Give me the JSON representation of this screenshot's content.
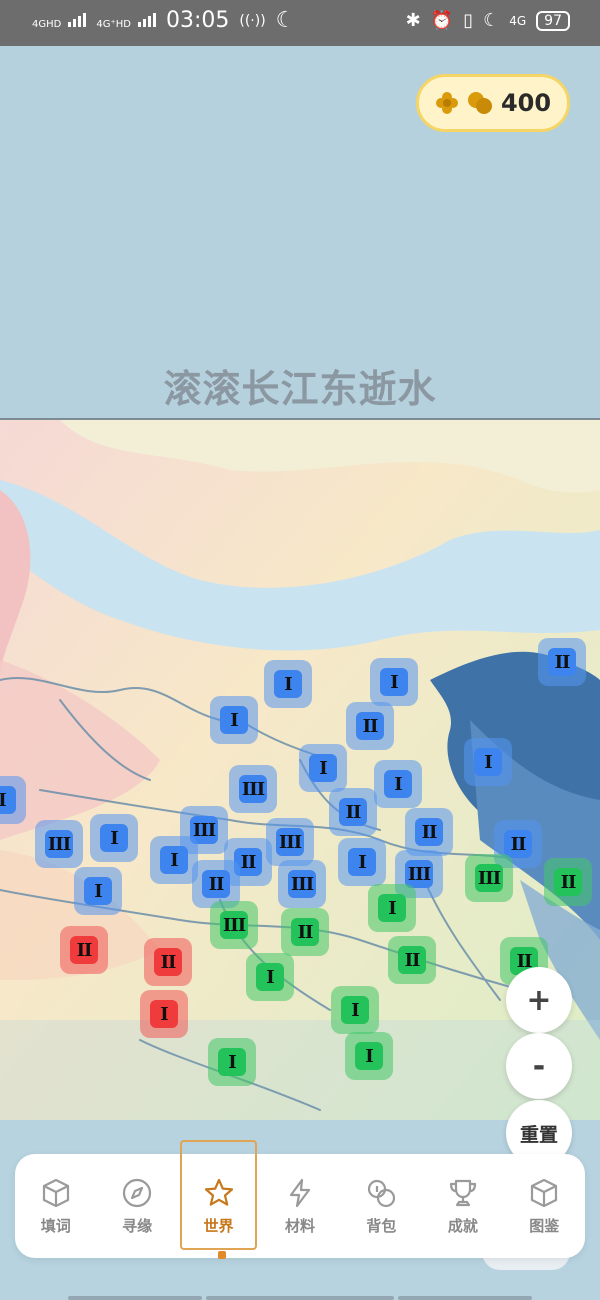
{
  "status_bar": {
    "net1": "4GHD",
    "net2": "4G⁺HD",
    "time": "03:05",
    "net3": "4G",
    "battery": "97"
  },
  "currency": {
    "amount": "400",
    "icon": "coins-icon",
    "flower_icon": "flower-icon"
  },
  "title": "滚滚长江东逝水",
  "map_nodes": [
    {
      "label": "I",
      "color": "blue"
    },
    {
      "label": "I",
      "color": "blue"
    },
    {
      "label": "II",
      "color": "blue"
    },
    {
      "label": "I",
      "color": "blue"
    },
    {
      "label": "II",
      "color": "blue"
    },
    {
      "label": "III",
      "color": "blue"
    },
    {
      "label": "I",
      "color": "blue"
    },
    {
      "label": "I",
      "color": "blue"
    },
    {
      "label": "I",
      "color": "blue"
    },
    {
      "label": "II",
      "color": "blue"
    },
    {
      "label": "III",
      "color": "blue"
    },
    {
      "label": "II",
      "color": "blue"
    },
    {
      "label": "III",
      "color": "blue"
    },
    {
      "label": "I",
      "color": "blue"
    },
    {
      "label": "III",
      "color": "blue"
    },
    {
      "label": "I",
      "color": "blue"
    },
    {
      "label": "II",
      "color": "blue"
    },
    {
      "label": "I",
      "color": "blue"
    },
    {
      "label": "II",
      "color": "blue"
    },
    {
      "label": "III",
      "color": "blue"
    },
    {
      "label": "III",
      "color": "blue"
    },
    {
      "label": "II",
      "color": "blue"
    },
    {
      "label": "I",
      "color": "blue"
    },
    {
      "label": "III",
      "color": "green"
    },
    {
      "label": "II",
      "color": "green"
    },
    {
      "label": "I",
      "color": "green"
    },
    {
      "label": "III",
      "color": "green"
    },
    {
      "label": "II",
      "color": "green"
    },
    {
      "label": "I",
      "color": "green"
    },
    {
      "label": "II",
      "color": "green"
    },
    {
      "label": "II",
      "color": "green"
    },
    {
      "label": "I",
      "color": "green"
    },
    {
      "label": "I",
      "color": "green"
    },
    {
      "label": "I",
      "color": "green"
    },
    {
      "label": "II",
      "color": "red"
    },
    {
      "label": "II",
      "color": "red"
    },
    {
      "label": "I",
      "color": "red"
    },
    {
      "label": "I",
      "color": "blue"
    }
  ],
  "zoom": {
    "in": "+",
    "out": "-",
    "reset": "重置",
    "level": "150%"
  },
  "nav": [
    {
      "label": "填词",
      "icon": "cube-icon"
    },
    {
      "label": "寻缘",
      "icon": "compass-icon"
    },
    {
      "label": "世界",
      "icon": "star-icon",
      "active": true
    },
    {
      "label": "材料",
      "icon": "lightning-icon"
    },
    {
      "label": "背包",
      "icon": "coins-icon"
    },
    {
      "label": "成就",
      "icon": "trophy-icon"
    },
    {
      "label": "图鉴",
      "icon": "box-icon"
    }
  ],
  "colors": {
    "accent": "#c6781b",
    "blue_node": "#3d84ef",
    "green_node": "#24c25a",
    "red_node": "#ef3b3b",
    "coin_pill": "#fff4c9"
  }
}
